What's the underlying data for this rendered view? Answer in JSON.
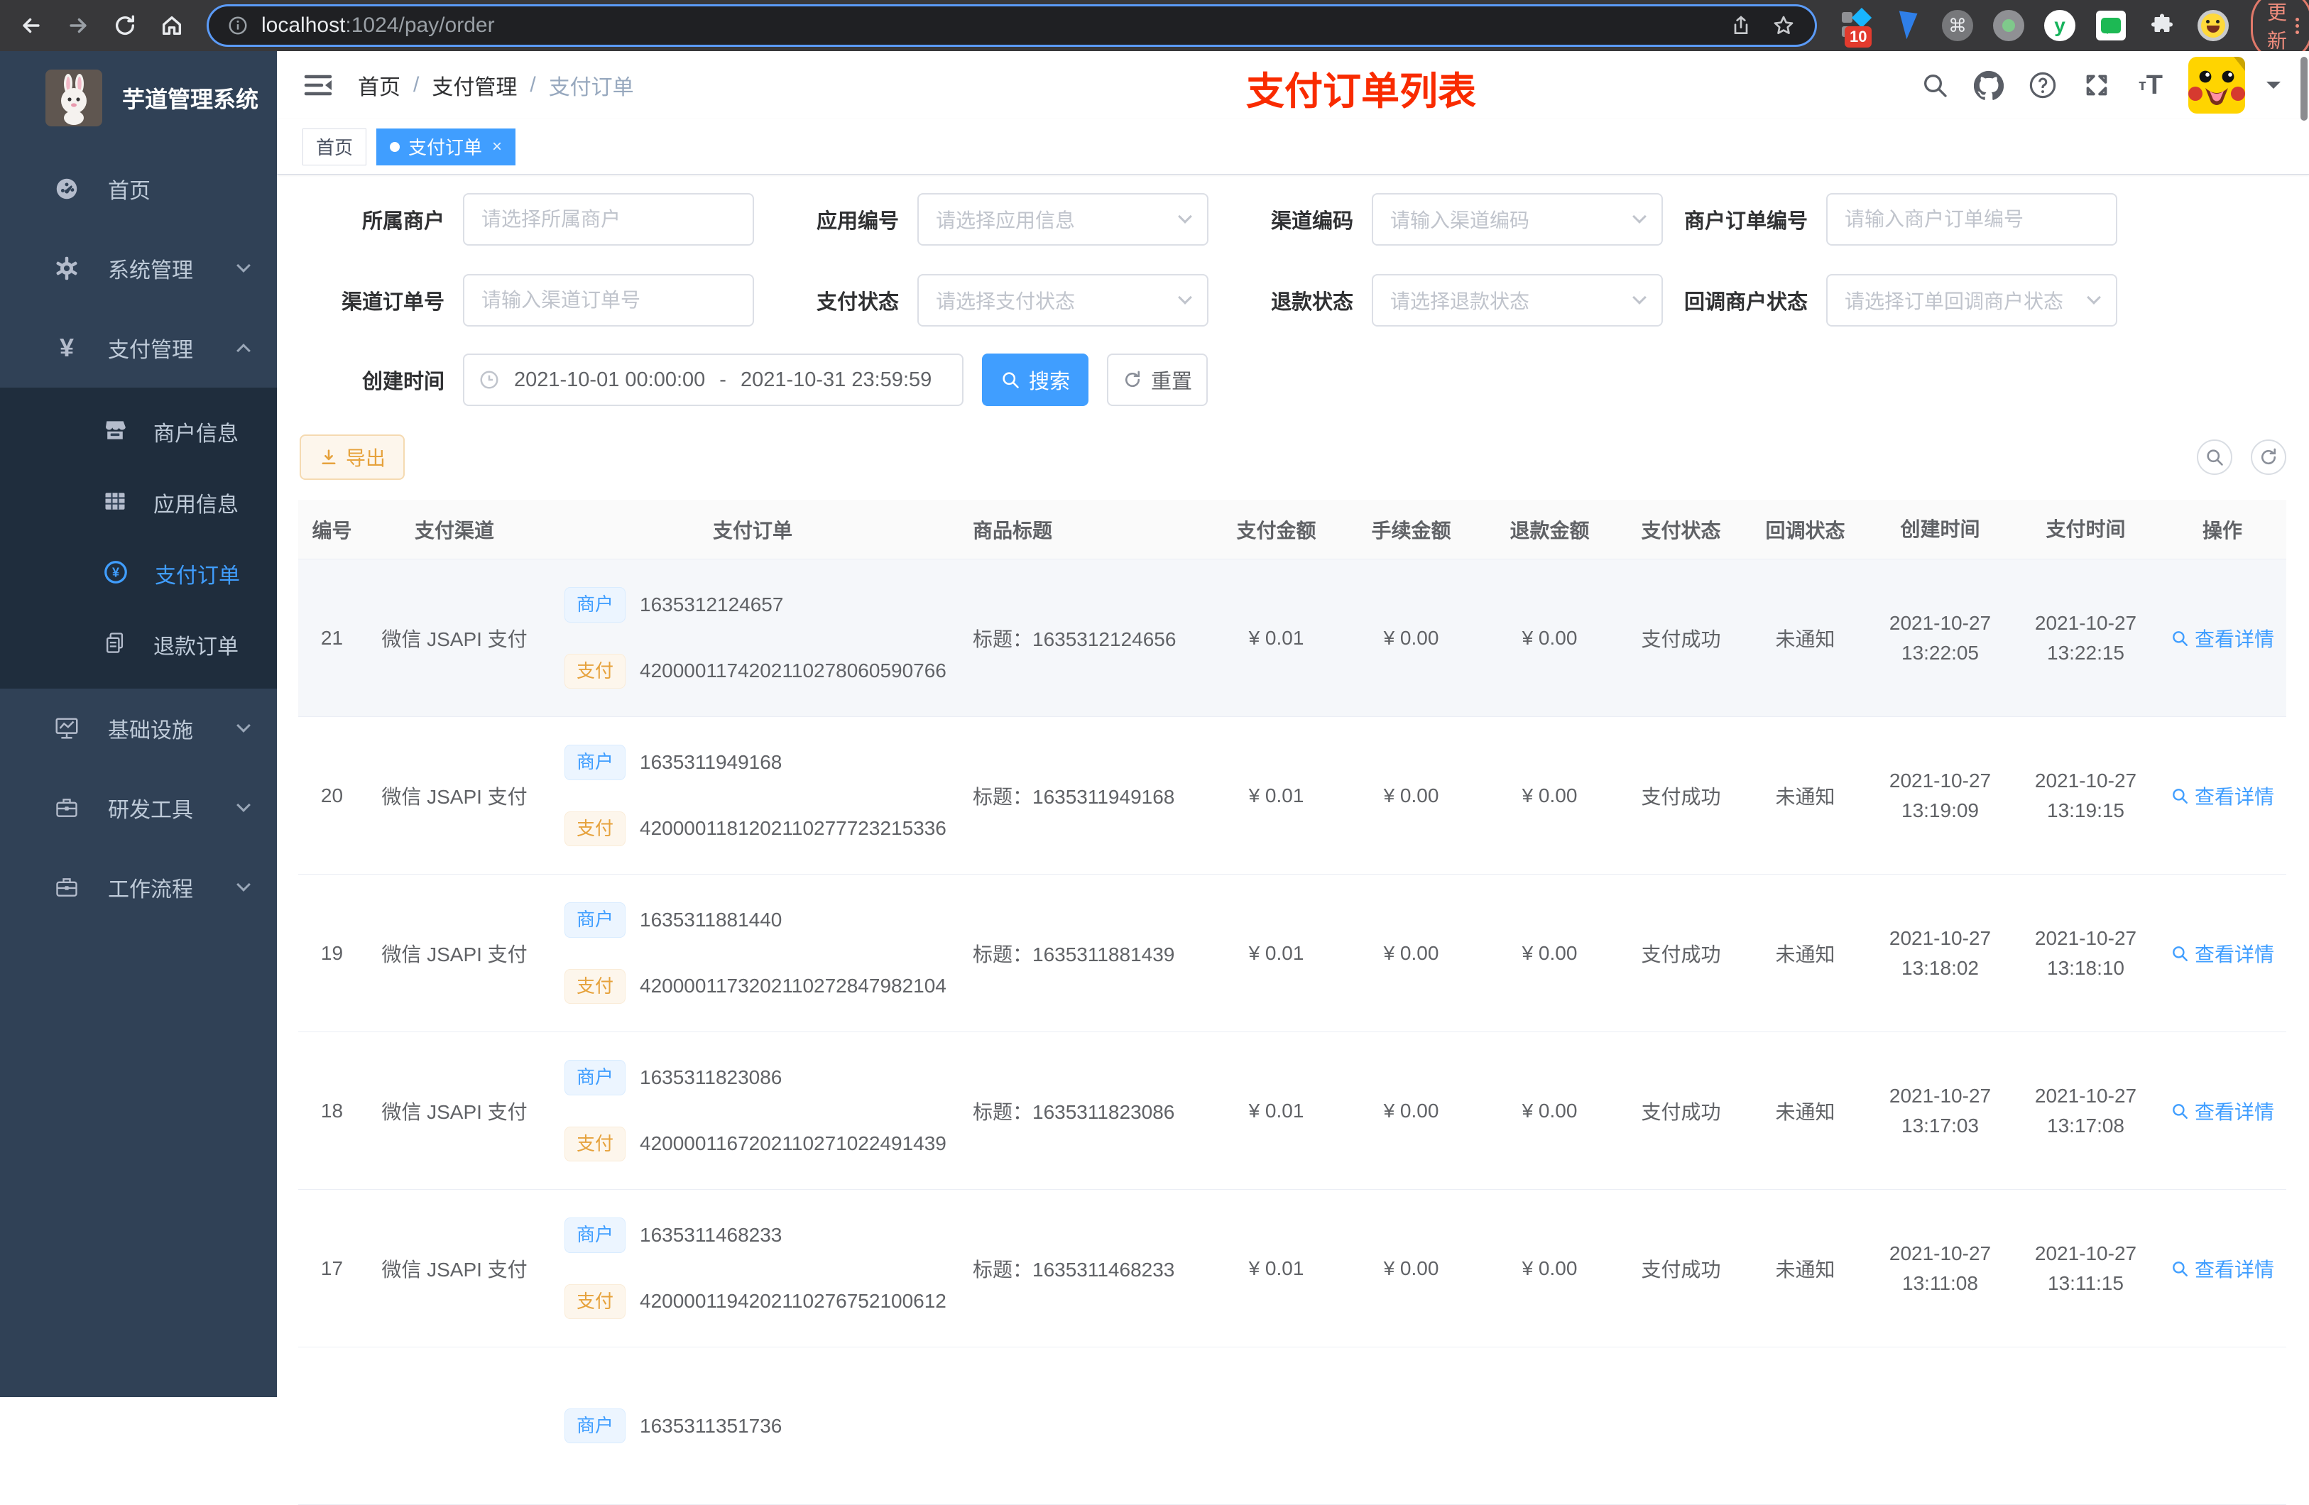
{
  "browser": {
    "url_host": "localhost",
    "url_rest": ":1024/pay/order",
    "update_label": "更新",
    "extension_badge": "10"
  },
  "sidebar": {
    "logo_title": "芋道管理系统",
    "menu": {
      "home": "首页",
      "system": "系统管理",
      "payment": "支付管理",
      "infra": "基础设施",
      "devtools": "研发工具",
      "workflow": "工作流程"
    },
    "submenu": {
      "merchant": "商户信息",
      "app": "应用信息",
      "pay_order": "支付订单",
      "refund_order": "退款订单"
    }
  },
  "navbar": {
    "breadcrumb": [
      "首页",
      "支付管理",
      "支付订单"
    ],
    "annotation": "支付订单列表"
  },
  "tags": {
    "home": "首页",
    "active": "支付订单",
    "close": "×"
  },
  "filters": {
    "merchant": {
      "label": "所属商户",
      "placeholder": "请选择所属商户"
    },
    "app_no": {
      "label": "应用编号",
      "placeholder": "请选择应用信息"
    },
    "channel_code": {
      "label": "渠道编码",
      "placeholder": "请输入渠道编码"
    },
    "merchant_order_no": {
      "label": "商户订单编号",
      "placeholder": "请输入商户订单编号"
    },
    "channel_order_no": {
      "label": "渠道订单号",
      "placeholder": "请输入渠道订单号"
    },
    "pay_status": {
      "label": "支付状态",
      "placeholder": "请选择支付状态"
    },
    "refund_status": {
      "label": "退款状态",
      "placeholder": "请选择退款状态"
    },
    "callback_status": {
      "label": "回调商户状态",
      "placeholder": "请选择订单回调商户状态"
    },
    "create_time": {
      "label": "创建时间",
      "start": "2021-10-01 00:00:00",
      "separator": "-",
      "end": "2021-10-31 23:59:59"
    },
    "search_label": "搜索",
    "reset_label": "重置"
  },
  "toolbar": {
    "export_label": "导出"
  },
  "table": {
    "columns": [
      "编号",
      "支付渠道",
      "支付订单",
      "商品标题",
      "支付金额",
      "手续金额",
      "退款金额",
      "支付状态",
      "回调状态",
      "创建时间",
      "支付时间",
      "操作"
    ],
    "merchant_tag": "商户",
    "pay_tag": "支付",
    "action_label": "查看详情",
    "rows": [
      {
        "id": "21",
        "channel": "微信 JSAPI 支付",
        "merchant_no": "1635312124657",
        "pay_no": "4200001174202110278060590766",
        "title": "标题：1635312124656",
        "amount": "¥ 0.01",
        "fee": "¥ 0.00",
        "refund": "¥ 0.00",
        "pay_status": "支付成功",
        "notify_status": "未通知",
        "create_date": "2021-10-27",
        "create_time": "13:22:05",
        "pay_date": "2021-10-27",
        "pay_time": "13:22:15",
        "hover": true
      },
      {
        "id": "20",
        "channel": "微信 JSAPI 支付",
        "merchant_no": "1635311949168",
        "pay_no": "4200001181202110277723215336",
        "title": "标题：1635311949168",
        "amount": "¥ 0.01",
        "fee": "¥ 0.00",
        "refund": "¥ 0.00",
        "pay_status": "支付成功",
        "notify_status": "未通知",
        "create_date": "2021-10-27",
        "create_time": "13:19:09",
        "pay_date": "2021-10-27",
        "pay_time": "13:19:15",
        "hover": false
      },
      {
        "id": "19",
        "channel": "微信 JSAPI 支付",
        "merchant_no": "1635311881440",
        "pay_no": "4200001173202110272847982104",
        "title": "标题：1635311881439",
        "amount": "¥ 0.01",
        "fee": "¥ 0.00",
        "refund": "¥ 0.00",
        "pay_status": "支付成功",
        "notify_status": "未通知",
        "create_date": "2021-10-27",
        "create_time": "13:18:02",
        "pay_date": "2021-10-27",
        "pay_time": "13:18:10",
        "hover": false
      },
      {
        "id": "18",
        "channel": "微信 JSAPI 支付",
        "merchant_no": "1635311823086",
        "pay_no": "4200001167202110271022491439",
        "title": "标题：1635311823086",
        "amount": "¥ 0.01",
        "fee": "¥ 0.00",
        "refund": "¥ 0.00",
        "pay_status": "支付成功",
        "notify_status": "未通知",
        "create_date": "2021-10-27",
        "create_time": "13:17:03",
        "pay_date": "2021-10-27",
        "pay_time": "13:17:08",
        "hover": false
      },
      {
        "id": "17",
        "channel": "微信 JSAPI 支付",
        "merchant_no": "1635311468233",
        "pay_no": "4200001194202110276752100612",
        "title": "标题：1635311468233",
        "amount": "¥ 0.01",
        "fee": "¥ 0.00",
        "refund": "¥ 0.00",
        "pay_status": "支付成功",
        "notify_status": "未通知",
        "create_date": "2021-10-27",
        "create_time": "13:11:08",
        "pay_date": "2021-10-27",
        "pay_time": "13:11:15",
        "hover": false
      },
      {
        "id": "",
        "channel": "",
        "merchant_no": "1635311351736",
        "pay_no": "",
        "title": "",
        "amount": "",
        "fee": "",
        "refund": "",
        "pay_status": "",
        "notify_status": "",
        "create_date": "",
        "create_time": "",
        "pay_date": "",
        "pay_time": "",
        "hover": false
      }
    ]
  }
}
